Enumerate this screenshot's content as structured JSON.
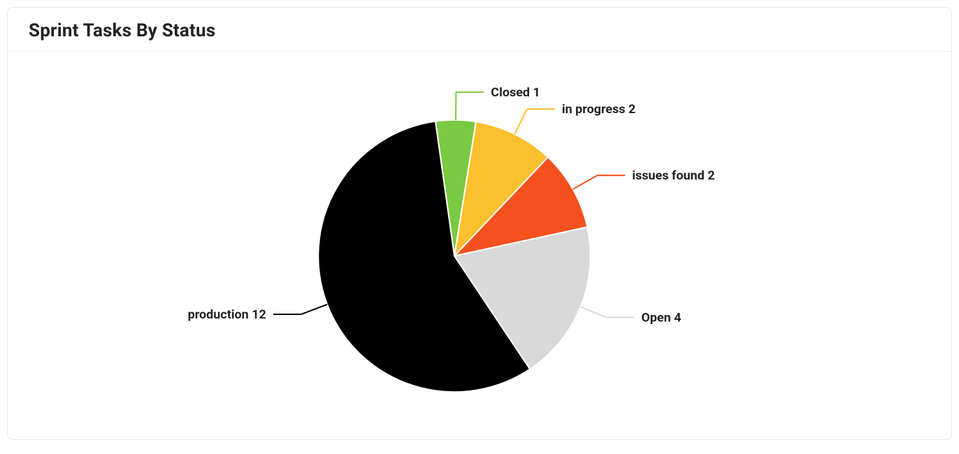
{
  "card": {
    "title": "Sprint Tasks By Status"
  },
  "chart_data": {
    "type": "pie",
    "title": "Sprint Tasks By Status",
    "series": [
      {
        "name": "Closed",
        "value": 1,
        "color": "#7ac943"
      },
      {
        "name": "in progress",
        "value": 2,
        "color": "#fbc02d"
      },
      {
        "name": "issues found",
        "value": 2,
        "color": "#f4511e"
      },
      {
        "name": "Open",
        "value": 4,
        "color": "#d9d9d9"
      },
      {
        "name": "production",
        "value": 12,
        "color": "#000000"
      }
    ]
  }
}
